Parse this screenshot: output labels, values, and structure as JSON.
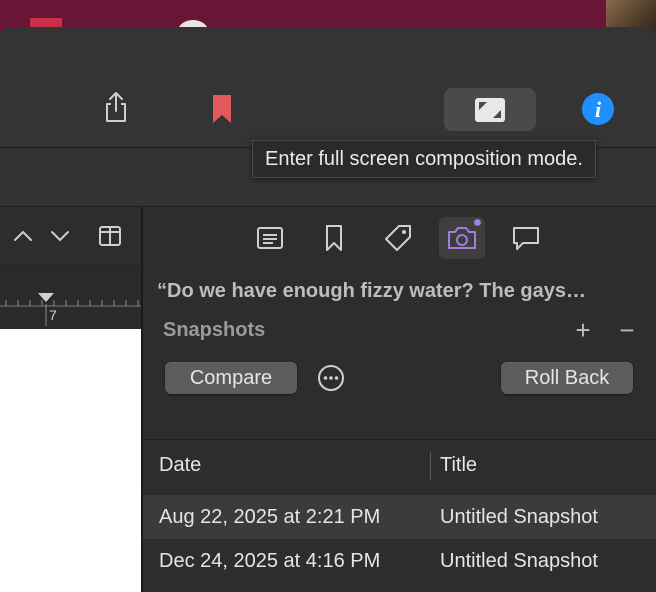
{
  "toolbar": {
    "share": "share-icon",
    "bookmark": "bookmark-icon",
    "fullscreen": "fullscreen-composition-icon",
    "info": "info-icon"
  },
  "tooltip": {
    "text": "Enter full screen composition mode."
  },
  "editor": {
    "ruler_number": "7"
  },
  "inspector": {
    "tabs": [
      {
        "name": "formatting-icon",
        "active": false
      },
      {
        "name": "bookmark-icon",
        "active": false
      },
      {
        "name": "tag-icon",
        "active": false
      },
      {
        "name": "camera-icon",
        "active": true
      },
      {
        "name": "comment-icon",
        "active": false
      }
    ],
    "document_title": "“Do we have enough fizzy water? The gays…",
    "snapshots_heading": "Snapshots",
    "plus": "+",
    "minus": "−",
    "compare_label": "Compare",
    "rollback_label": "Roll Back",
    "table": {
      "headers": {
        "date": "Date",
        "title": "Title"
      },
      "rows": [
        {
          "date": "Aug 22, 2025 at 2:21 PM",
          "title": "Untitled Snapshot",
          "selected": true
        },
        {
          "date": "Dec 24, 2025 at 4:16 PM",
          "title": "Untitled Snapshot",
          "selected": false
        }
      ]
    }
  },
  "colors": {
    "accent": "#a67be0",
    "bookmark_red": "#e05a5a",
    "info_blue": "#1e90ff"
  }
}
